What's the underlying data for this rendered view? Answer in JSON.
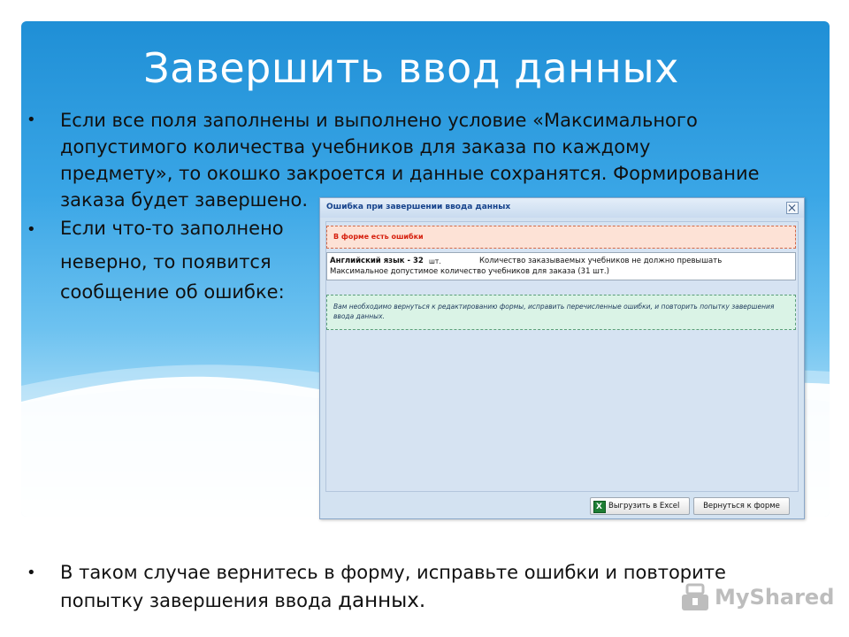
{
  "slide": {
    "title": "Завершить ввод данных",
    "bullets": [
      {
        "lines": [
          "Если все поля заполнены и выполнено условие «Максимального",
          "допустимого количества учебников для заказа по каждому",
          "предмету», то окошко закроется и данные сохранятся. Формирование",
          "заказа будет завершено."
        ]
      },
      {
        "lines": [
          "Если что-то заполнено",
          "неверно, то появится",
          "сообщение об ошибке:"
        ]
      },
      {
        "lines": [
          "В таком случае вернитесь в форму, исправьте ошибки и повторите",
          "попытку завершения ввода"
        ],
        "tail": "данных."
      }
    ]
  },
  "dialog": {
    "title": "Ошибка при завершении ввода данных",
    "error_header": "В форме есть ошибки",
    "item": {
      "subject": "Английский язык - 32",
      "unit": "шт.",
      "message": "Количество заказываемых учебников не должно превышать",
      "line2": "Максимальное допустимое количество учебников для заказа (31 шт.)"
    },
    "info": "Вам необходимо вернуться к редактированию формы, исправить перечисленные ошибки, и повторить попытку завершения ввода данных.",
    "buttons": {
      "export": "Выгрузить в Excel",
      "back": "Вернуться к форме"
    }
  },
  "watermark": "MyShared",
  "icons": [
    "close-icon",
    "excel-icon",
    "myshared-logo-icon"
  ],
  "colors": {
    "sky_top": "#1f8fd6",
    "title_text": "#ffffff",
    "error_text": "#d6200e",
    "dialog_title_text": "#15428b"
  }
}
